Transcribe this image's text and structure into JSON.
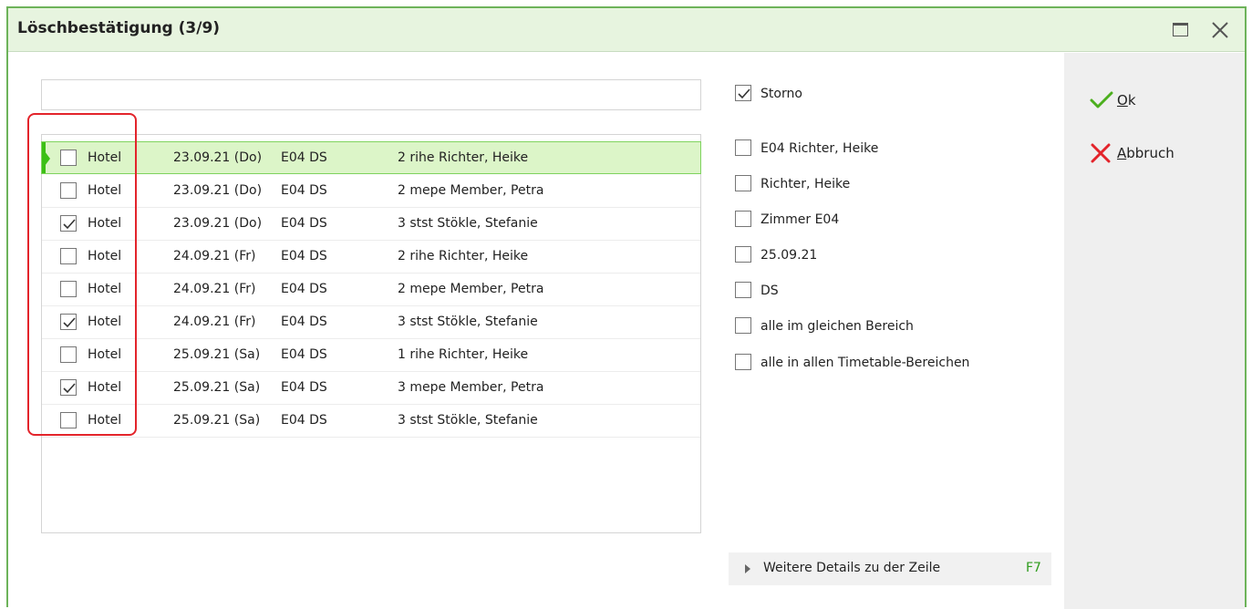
{
  "window": {
    "title": "Löschbestätigung (3/9)"
  },
  "rows": [
    {
      "checked": false,
      "type": "Hotel",
      "date": "23.09.21 (Do)",
      "room": "E04 DS",
      "guest": "2 rihe  Richter, Heike",
      "selected": true
    },
    {
      "checked": false,
      "type": "Hotel",
      "date": "23.09.21 (Do)",
      "room": "E04 DS",
      "guest": "2 mepe  Member, Petra",
      "selected": false
    },
    {
      "checked": true,
      "type": "Hotel",
      "date": "23.09.21 (Do)",
      "room": "E04 DS",
      "guest": "3 stst  Stökle, Stefanie",
      "selected": false
    },
    {
      "checked": false,
      "type": "Hotel",
      "date": "24.09.21 (Fr)",
      "room": "E04 DS",
      "guest": "2 rihe  Richter, Heike",
      "selected": false
    },
    {
      "checked": false,
      "type": "Hotel",
      "date": "24.09.21 (Fr)",
      "room": "E04 DS",
      "guest": "2 mepe  Member, Petra",
      "selected": false
    },
    {
      "checked": true,
      "type": "Hotel",
      "date": "24.09.21 (Fr)",
      "room": "E04 DS",
      "guest": "3 stst  Stökle, Stefanie",
      "selected": false
    },
    {
      "checked": false,
      "type": "Hotel",
      "date": "25.09.21 (Sa)",
      "room": "E04 DS",
      "guest": "1 rihe  Richter, Heike",
      "selected": false
    },
    {
      "checked": true,
      "type": "Hotel",
      "date": "25.09.21 (Sa)",
      "room": "E04 DS",
      "guest": "3 mepe  Member, Petra",
      "selected": false
    },
    {
      "checked": false,
      "type": "Hotel",
      "date": "25.09.21 (Sa)",
      "room": "E04 DS",
      "guest": "3 stst  Stökle, Stefanie",
      "selected": false
    }
  ],
  "options": {
    "storno": {
      "label": "Storno",
      "checked": true
    },
    "items": [
      {
        "label": "E04 Richter, Heike",
        "checked": false
      },
      {
        "label": "Richter, Heike",
        "checked": false
      },
      {
        "label": "Zimmer E04",
        "checked": false
      },
      {
        "label": "25.09.21",
        "checked": false
      },
      {
        "label": "DS",
        "checked": false
      },
      {
        "label": "alle im gleichen Bereich",
        "checked": false
      },
      {
        "label": "alle in allen Timetable-Bereichen",
        "checked": false
      }
    ]
  },
  "details": {
    "label": "Weitere Details zu der Zeile",
    "key": "F7"
  },
  "actions": {
    "ok": {
      "mnemonic": "O",
      "rest": "k",
      "icon": "checkmark-icon",
      "color": "#4caf1e"
    },
    "cancel": {
      "mnemonic": "A",
      "rest": "bbruch",
      "icon": "x-icon",
      "color": "#e3242b"
    }
  },
  "colors": {
    "accent": "#6db35a",
    "selection": "#dcf5c8",
    "highlight_frame": "#e3242b"
  }
}
